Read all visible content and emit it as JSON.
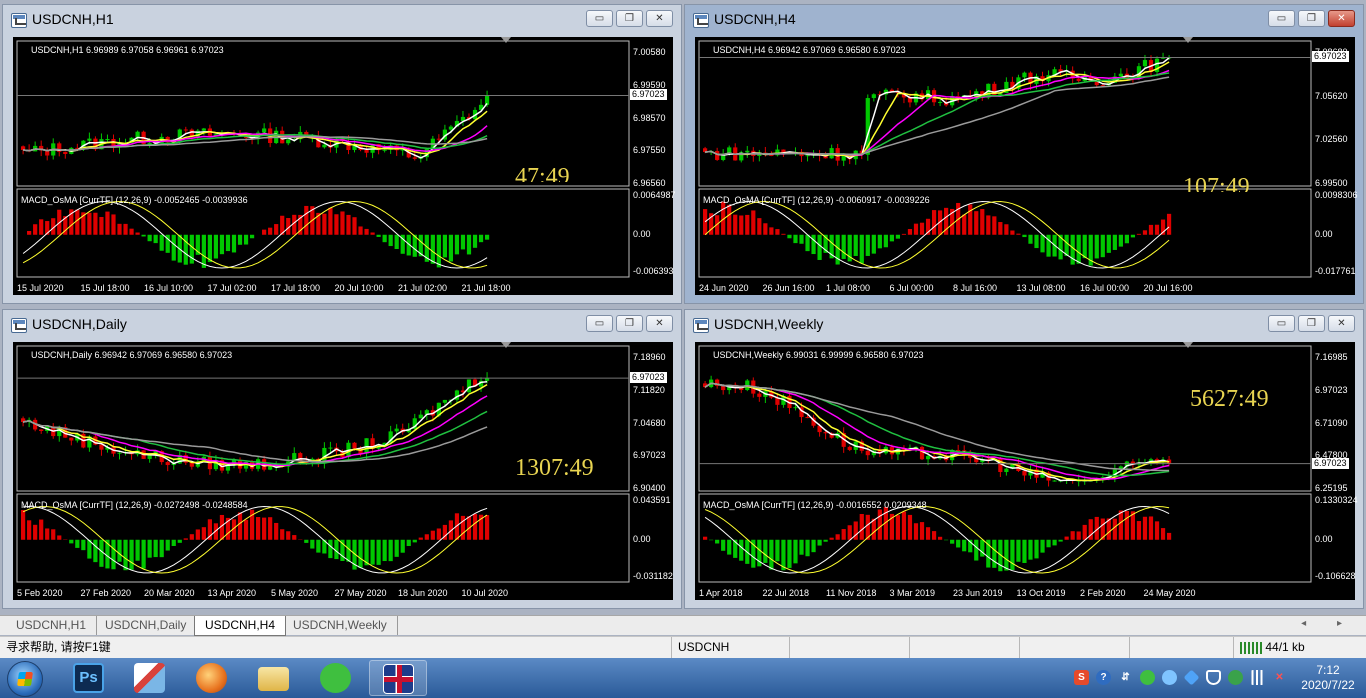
{
  "colors": {
    "bull": "#00c800",
    "bear": "#e00000",
    "ma_white": "#ffffff",
    "ma_yellow": "#ffff30",
    "ma_magenta": "#ff00ff",
    "ma_green": "#20c040",
    "ma_gray": "#9a9a9a",
    "timer": "#e8d451"
  },
  "windows": [
    {
      "id": "h1",
      "title": "USDCNH,H1",
      "active": false,
      "header": "USDCNH,H1  6.96989 6.97058 6.96961 6.97023",
      "price_scale": [
        "7.00580",
        "6.99590",
        "6.98570",
        "6.97550",
        "6.96560"
      ],
      "price_tag": "6.97023",
      "timer": "47:49",
      "osc_header": "MACD_OsMA [CurrTF] (12,26,9) -0.0052465 -0.0039936",
      "osc_scale": [
        "0.0064987",
        "0.00",
        "-0.006393"
      ],
      "x_labels": [
        "15 Jul 2020",
        "15 Jul 18:00",
        "16 Jul 10:00",
        "17 Jul 02:00",
        "17 Jul 18:00",
        "20 Jul 10:00",
        "21 Jul 02:00",
        "21 Jul 18:00"
      ]
    },
    {
      "id": "h4",
      "title": "USDCNH,H4",
      "active": true,
      "header": "USDCNH,H4  6.96942 6.97069 6.96580 6.97023",
      "price_scale": [
        "7.08680",
        "7.05620",
        "7.02560",
        "6.99500"
      ],
      "price_tag": "6.97023",
      "timer": "107:49",
      "osc_header": "MACD_OsMA [CurrTF] (12,26,9) -0.0060917 -0.0039226",
      "osc_scale": [
        "0.0098306",
        "0.00",
        "-0.017761"
      ],
      "x_labels": [
        "24 Jun 2020",
        "26 Jun 16:00",
        "1 Jul 08:00",
        "6 Jul 00:00",
        "8 Jul 16:00",
        "13 Jul 08:00",
        "16 Jul 00:00",
        "20 Jul 16:00"
      ]
    },
    {
      "id": "daily",
      "title": "USDCNH,Daily",
      "active": false,
      "header": "USDCNH,Daily  6.96942 6.97069 6.96580 6.97023",
      "price_scale": [
        "7.18960",
        "7.11820",
        "7.04680",
        "6.97023",
        "6.90400"
      ],
      "price_tag": "6.97023",
      "timer": "1307:49",
      "osc_header": "MACD_OsMA [CurrTF] (12,26,9) -0.0272498 -0.0248584",
      "osc_scale": [
        "0.043591",
        "0.00",
        "-0.031182"
      ],
      "x_labels": [
        "5 Feb 2020",
        "27 Feb 2020",
        "20 Mar 2020",
        "13 Apr 2020",
        "5 May 2020",
        "27 May 2020",
        "18 Jun 2020",
        "10 Jul 2020"
      ]
    },
    {
      "id": "weekly",
      "title": "USDCNH,Weekly",
      "active": false,
      "header": "USDCNH,Weekly  6.99031 6.99999 6.96580 6.97023",
      "price_scale": [
        "7.16985",
        "6.97023",
        "6.71090",
        "6.47800",
        "6.25195"
      ],
      "price_tag": "6.97023",
      "timer": "5627:49",
      "osc_header": "MACD_OsMA [CurrTF] (12,26,9) -0.0016552 0.0209348",
      "osc_scale": [
        "0.1330324",
        "0.00",
        "-0.106628"
      ],
      "x_labels": [
        "1 Apr 2018",
        "22 Jul 2018",
        "11 Nov 2018",
        "3 Mar 2019",
        "23 Jun 2019",
        "13 Oct 2019",
        "2 Feb 2020",
        "24 May 2020"
      ]
    }
  ],
  "window_buttons": {
    "minimize": "▭",
    "restore": "❐",
    "close": "✕"
  },
  "tabs": [
    "USDCNH,H1",
    "USDCNH,Daily",
    "USDCNH,H4",
    "USDCNH,Weekly"
  ],
  "active_tab": "USDCNH,H4",
  "tab_arrows": "◂ ▸",
  "status": {
    "help": "寻求帮助, 请按F1键",
    "symbol": "USDCNH",
    "traffic": "44/1 kb"
  },
  "taskbar": {
    "apps": [
      "start-button",
      "photoshop",
      "paint-app",
      "browser-app",
      "file-explorer",
      "wechat-app",
      "uk-flag-app"
    ],
    "photoshop_label": "Ps",
    "time": "7:12",
    "date": "2020/7/22"
  }
}
